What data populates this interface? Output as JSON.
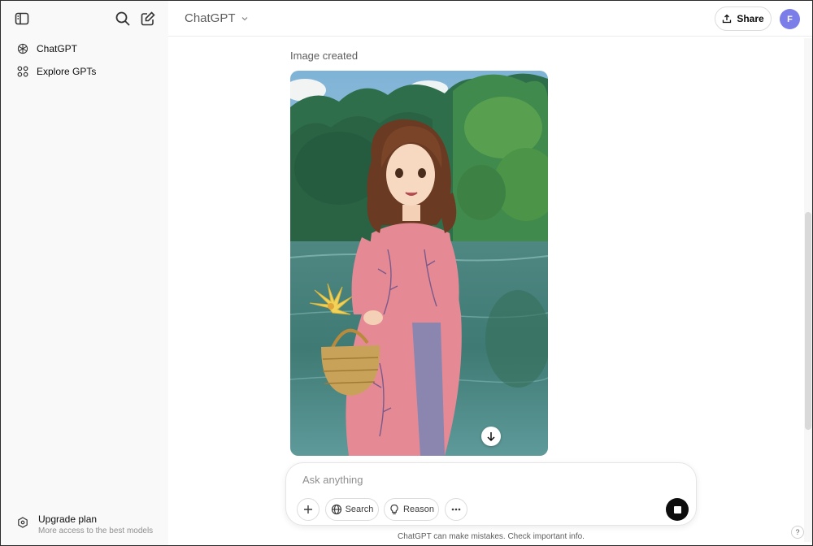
{
  "header": {
    "model_name": "ChatGPT",
    "share_label": "Share",
    "avatar_initial": "F"
  },
  "sidebar": {
    "items": [
      {
        "label": "ChatGPT",
        "icon": "openai-logo-icon"
      },
      {
        "label": "Explore GPTs",
        "icon": "grid-icon"
      }
    ],
    "upgrade": {
      "title": "Upgrade plan",
      "subtitle": "More access to the best models"
    }
  },
  "main": {
    "caption": "Image created",
    "image": {
      "subject": "anime-style woman in pink ao dai holding a wicker basket with a yellow flower by a lake"
    }
  },
  "composer": {
    "placeholder": "Ask anything",
    "value": "",
    "search_label": "Search",
    "reason_label": "Reason"
  },
  "footer": {
    "disclaimer": "ChatGPT can make mistakes. Check important info.",
    "help": "?"
  },
  "colors": {
    "sidebar_bg": "#f9f9f9",
    "avatar": "#7b7de8",
    "dress": "#e58a95",
    "water": "#3f7a74",
    "foliage": "#2f7a4e"
  }
}
